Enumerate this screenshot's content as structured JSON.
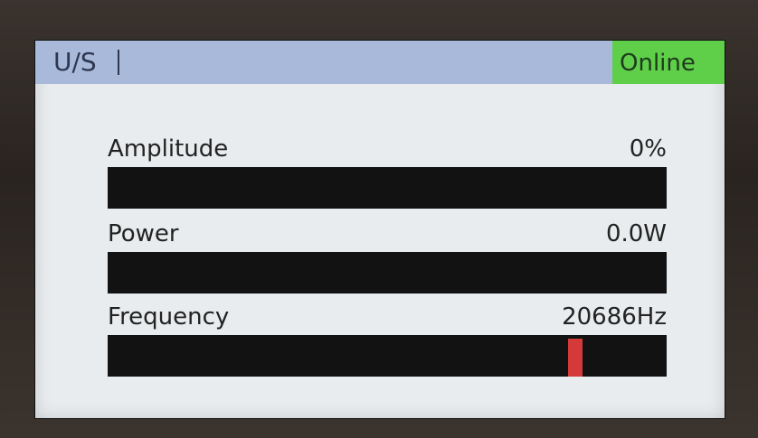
{
  "header": {
    "title": "U/S",
    "status": "Online",
    "colors": {
      "titlebar": "#a9b9d9",
      "status_bg": "#5fcf4a"
    }
  },
  "metrics": [
    {
      "label": "Amplitude",
      "value": "0%"
    },
    {
      "label": "Power",
      "value": "0.0W"
    },
    {
      "label": "Frequency",
      "value": "20686Hz"
    }
  ],
  "frequency_marker": {
    "position_fraction": 0.823,
    "color": "#d43a3a"
  }
}
